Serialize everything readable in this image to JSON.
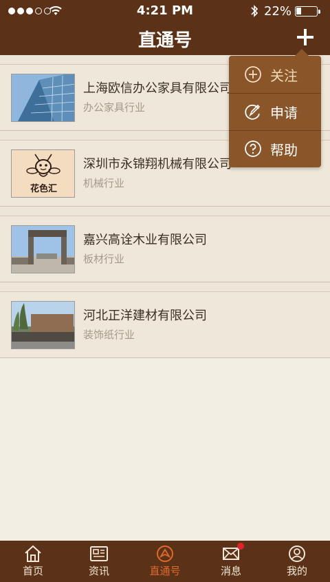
{
  "status_bar": {
    "time": "4:21 PM",
    "battery": "22%"
  },
  "header": {
    "title": "直通号"
  },
  "companies": [
    {
      "name": "上海欧信办公家具有限公司",
      "industry": "办公家具行业"
    },
    {
      "name": "深圳市永锦翔机械有限公司",
      "industry": "机械行业"
    },
    {
      "name": "嘉兴高诠木业有限公司",
      "industry": "板材行业"
    },
    {
      "name": "河北正洋建材有限公司",
      "industry": "装饰纸行业"
    }
  ],
  "logo_text": "花色汇",
  "popup_menu": [
    {
      "label": "关注",
      "icon": "plus-circle-icon"
    },
    {
      "label": "申请",
      "icon": "edit-circle-icon"
    },
    {
      "label": "帮助",
      "icon": "help-circle-icon"
    }
  ],
  "tabs": [
    {
      "label": "首页",
      "icon": "home-icon"
    },
    {
      "label": "资讯",
      "icon": "newspaper-icon"
    },
    {
      "label": "直通号",
      "icon": "compass-icon",
      "active": true
    },
    {
      "label": "消息",
      "icon": "mail-icon",
      "badge": true
    },
    {
      "label": "我的",
      "icon": "user-icon"
    }
  ],
  "colors": {
    "bar": "#5b3217",
    "menu": "#8a5629",
    "accent": "#e06a2b",
    "background": "#f3eee3"
  }
}
